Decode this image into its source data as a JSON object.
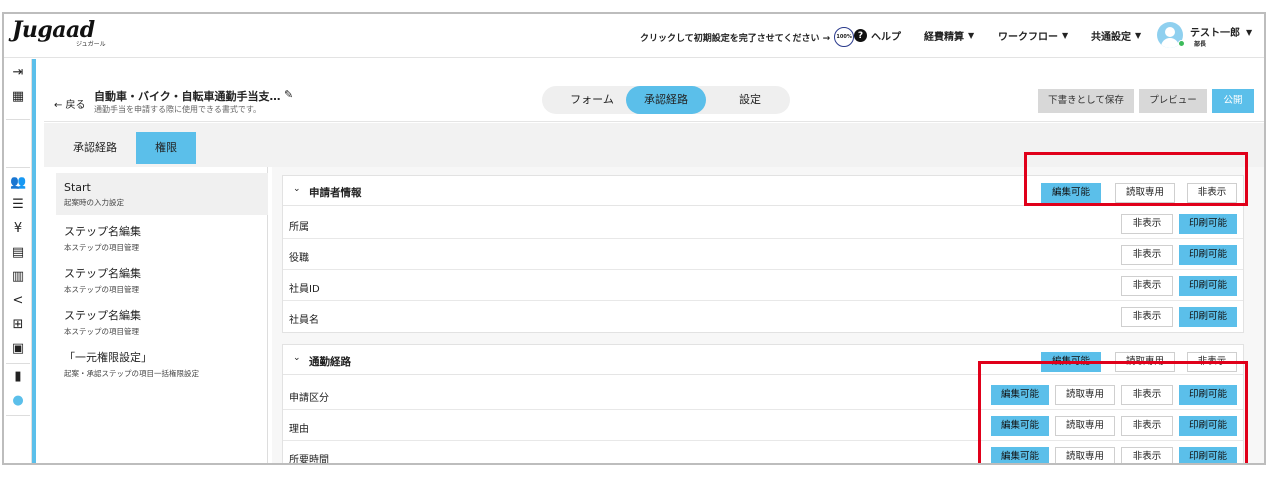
{
  "app": {
    "logo": "Jugaad",
    "logo_sub": "ジュガール"
  },
  "header": {
    "setup_text": "クリックして初期設定を完了させてください →",
    "setup_progress": "100%",
    "help": "ヘルプ",
    "nav": [
      "経費精算",
      "ワークフロー",
      "共通設定"
    ],
    "user_name": "テスト一郎",
    "user_role": "部長"
  },
  "page": {
    "back": "← 戻る",
    "title": "自動車・バイク・自転車通勤手当支…",
    "description": "通勤手当を申請する際に使用できる書式です。",
    "segments": [
      {
        "label": "フォーム",
        "active": false
      },
      {
        "label": "承認経路",
        "active": true
      },
      {
        "label": "設定",
        "active": false
      }
    ],
    "buttons": {
      "draft": "下書きとして保存",
      "preview": "プレビュー",
      "publish": "公開"
    }
  },
  "tabs": [
    {
      "label": "承認経路",
      "active": false
    },
    {
      "label": "権限",
      "active": true
    }
  ],
  "steps": [
    {
      "title": "Start",
      "sub": "起案時の入力設定",
      "active": true
    },
    {
      "title": "ステップ名編集",
      "sub": "本ステップの項目管理",
      "active": false
    },
    {
      "title": "ステップ名編集",
      "sub": "本ステップの項目管理",
      "active": false
    },
    {
      "title": "ステップ名編集",
      "sub": "本ステップの項目管理",
      "active": false
    },
    {
      "title": "「一元権限設定」",
      "sub": "起案・承認ステップの項目一括権限設定",
      "active": false
    }
  ],
  "perm_labels": {
    "edit": "編集可能",
    "read": "読取専用",
    "hide": "非表示",
    "print": "印刷可能"
  },
  "sections": [
    {
      "title": "申請者情報",
      "header_selected": "edit",
      "rows": [
        {
          "label": "所属",
          "selected": "print"
        },
        {
          "label": "役職",
          "selected": "print"
        },
        {
          "label": "社員ID",
          "selected": "print"
        },
        {
          "label": "社員名",
          "selected": "print"
        }
      ]
    },
    {
      "title": "通勤経路",
      "header_selected": "edit",
      "rows": [
        {
          "label": "申請区分",
          "selected": [
            "edit",
            "print"
          ]
        },
        {
          "label": "理由",
          "selected": [
            "edit",
            "print"
          ]
        },
        {
          "label": "所要時間",
          "selected": [
            "edit",
            "print"
          ]
        }
      ]
    }
  ],
  "colors": {
    "accent": "#5bbfea",
    "highlight": "#e0001a"
  }
}
